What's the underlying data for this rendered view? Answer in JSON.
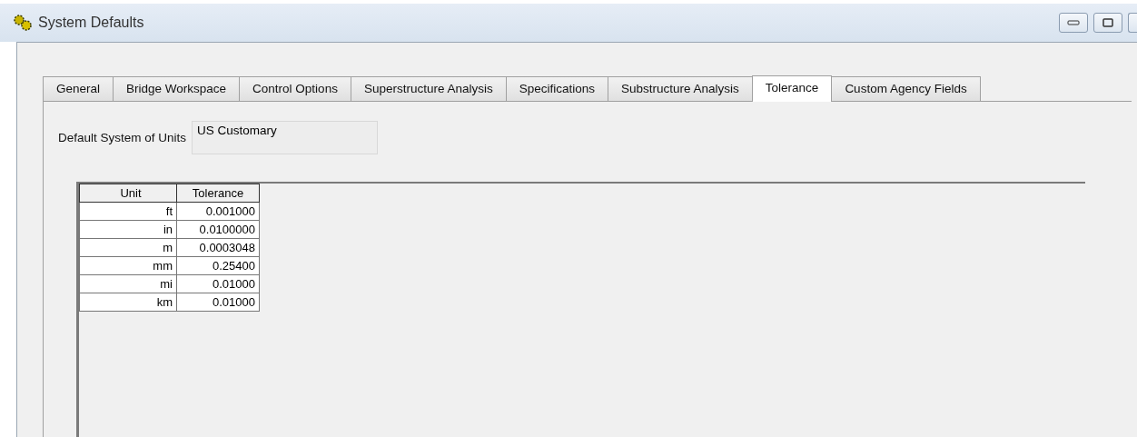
{
  "window": {
    "title": "System Defaults"
  },
  "tabs": [
    {
      "label": "General",
      "selected": false
    },
    {
      "label": "Bridge Workspace",
      "selected": false
    },
    {
      "label": "Control Options",
      "selected": false
    },
    {
      "label": "Superstructure Analysis",
      "selected": false
    },
    {
      "label": "Specifications",
      "selected": false
    },
    {
      "label": "Substructure Analysis",
      "selected": false
    },
    {
      "label": "Tolerance",
      "selected": true
    },
    {
      "label": "Custom Agency Fields",
      "selected": false
    }
  ],
  "units_field": {
    "label": "Default System of Units",
    "value": "US Customary"
  },
  "table": {
    "columns": [
      "Unit",
      "Tolerance"
    ],
    "rows": [
      [
        "ft",
        "0.001000"
      ],
      [
        "in",
        "0.0100000"
      ],
      [
        "m",
        "0.0003048"
      ],
      [
        "mm",
        "0.25400"
      ],
      [
        "mi",
        "0.01000"
      ],
      [
        "km",
        "0.01000"
      ]
    ]
  }
}
